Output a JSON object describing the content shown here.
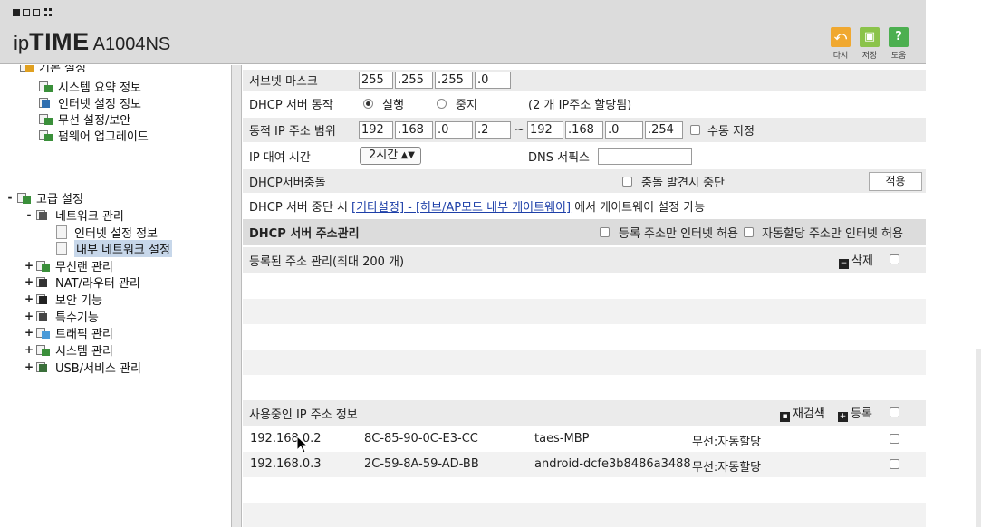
{
  "header": {
    "brand_prefix": "ip",
    "brand_main": "TIME",
    "brand_model": "A1004NS",
    "buttons": {
      "redo_label": "다시",
      "save_label": "저장",
      "help_label": "도움"
    }
  },
  "sidebar": {
    "partial_top_label": "기본 설정",
    "basic_items": [
      {
        "label": "시스템 요약 정보"
      },
      {
        "label": "인터넷 설정 정보"
      },
      {
        "label": "무선 설정/보안"
      },
      {
        "label": "펌웨어 업그레이드"
      }
    ],
    "advanced": {
      "label": "고급 설정",
      "expander": "-",
      "network": {
        "label": "네트워크 관리",
        "expander": "-",
        "children": [
          {
            "label": "인터넷 설정 정보"
          },
          {
            "label": "내부 네트워크 설정"
          }
        ]
      },
      "items": [
        {
          "label": "무선랜 관리",
          "expander": "+"
        },
        {
          "label": "NAT/라우터 관리",
          "expander": "+"
        },
        {
          "label": "보안 기능",
          "expander": "+"
        },
        {
          "label": "특수기능",
          "expander": "+"
        },
        {
          "label": "트래픽 관리",
          "expander": "+"
        },
        {
          "label": "시스템 관리",
          "expander": "+"
        },
        {
          "label": "USB/서비스 관리",
          "expander": "+"
        }
      ]
    }
  },
  "main": {
    "subnet": {
      "label": "서브넷 마스크",
      "octets": [
        "255",
        "255",
        "255",
        "0"
      ]
    },
    "dhcp_server": {
      "label": "DHCP 서버 동작",
      "option_run": "실행",
      "option_stop": "중지",
      "info": "(2 개 IP주소 할당됨)"
    },
    "dynamic_range": {
      "label": "동적 IP 주소 범위",
      "start": [
        "192",
        "168",
        "0",
        "2"
      ],
      "tilde": "~",
      "end": [
        "192",
        "168",
        "0",
        "254"
      ],
      "manual_label": "수동 지정"
    },
    "lease": {
      "label": "IP 대여 시간",
      "value": "2시간",
      "dns_suffix_label": "DNS 서픽스",
      "dns_suffix_value": ""
    },
    "conflict": {
      "label": "DHCP서버충돌",
      "stop_label": "충돌 발견시 중단",
      "apply_label": "적용"
    },
    "notice": {
      "before": "DHCP 서버 중단 시 ",
      "link": "[기타설정] - [허브/AP모드 내부 게이트웨이]",
      "after": " 에서 게이트웨이 설정 가능"
    },
    "address_mgmt": {
      "title": "DHCP 서버 주소관리",
      "opt_registered_only": "등록 주소만 인터넷 허용",
      "opt_auto_only": "자동할당 주소만 인터넷 허용"
    },
    "registered": {
      "title": "등록된 주소 관리(최대 200 개)",
      "delete_label": "삭제"
    },
    "in_use": {
      "title": "사용중인 IP 주소 정보",
      "rescan_label": "재검색",
      "register_label": "등록",
      "rows": [
        {
          "ip": "192.168.0.2",
          "mac": "8C-85-90-0C-E3-CC",
          "name": "taes-MBP",
          "type": "무선:자동할당"
        },
        {
          "ip": "192.168.0.3",
          "mac": "2C-59-8A-59-AD-BB",
          "name": "android-dcfe3b8486a3488",
          "type": "무선:자동할당"
        }
      ]
    }
  },
  "colors": {
    "header_bg": "#dcdcdc",
    "row_alt": "#ebebeb",
    "section_head": "#dcdcdc",
    "link": "#1d3fa8",
    "selected_bg": "#c7d7ea"
  }
}
